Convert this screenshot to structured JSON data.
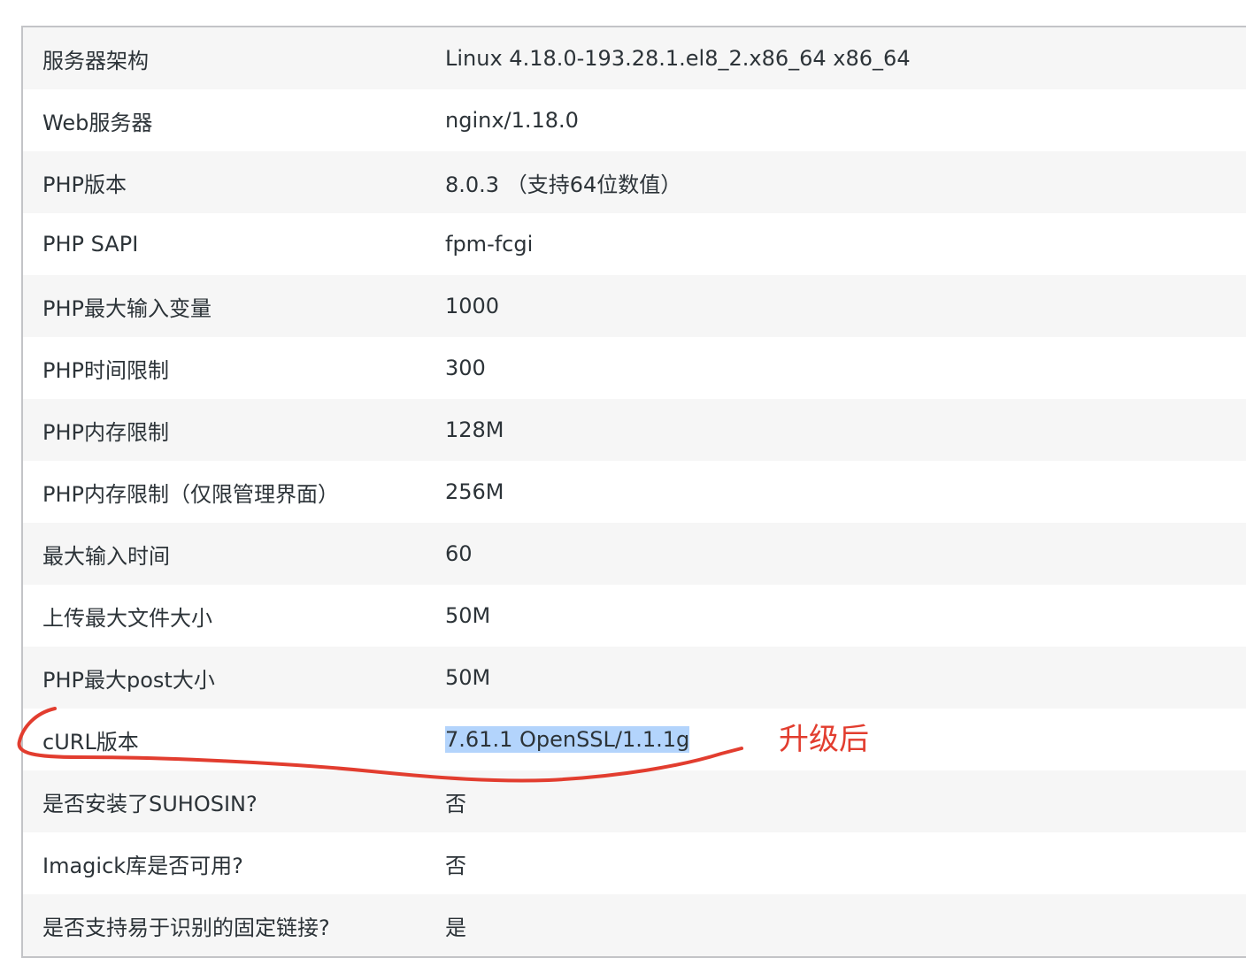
{
  "rows": [
    {
      "label": "服务器架构",
      "value": "Linux 4.18.0-193.28.1.el8_2.x86_64 x86_64"
    },
    {
      "label": "Web服务器",
      "value": "nginx/1.18.0"
    },
    {
      "label": "PHP版本",
      "value": "8.0.3 （支持64位数值）"
    },
    {
      "label": "PHP SAPI",
      "value": "fpm-fcgi"
    },
    {
      "label": "PHP最大输入变量",
      "value": "1000"
    },
    {
      "label": "PHP时间限制",
      "value": "300"
    },
    {
      "label": "PHP内存限制",
      "value": "128M"
    },
    {
      "label": "PHP内存限制（仅限管理界面）",
      "value": "256M"
    },
    {
      "label": "最大输入时间",
      "value": "60"
    },
    {
      "label": "上传最大文件大小",
      "value": "50M"
    },
    {
      "label": "PHP最大post大小",
      "value": "50M"
    },
    {
      "label": "cURL版本",
      "value": "7.61.1 OpenSSL/1.1.1g"
    },
    {
      "label": "是否安装了SUHOSIN?",
      "value": "否"
    },
    {
      "label": "Imagick库是否可用?",
      "value": "否"
    },
    {
      "label": "是否支持易于识别的固定链接?",
      "value": "是"
    }
  ],
  "annotation": {
    "text": "升级后",
    "color": "#e23d2f"
  },
  "selection_color": "#b3d4fc"
}
